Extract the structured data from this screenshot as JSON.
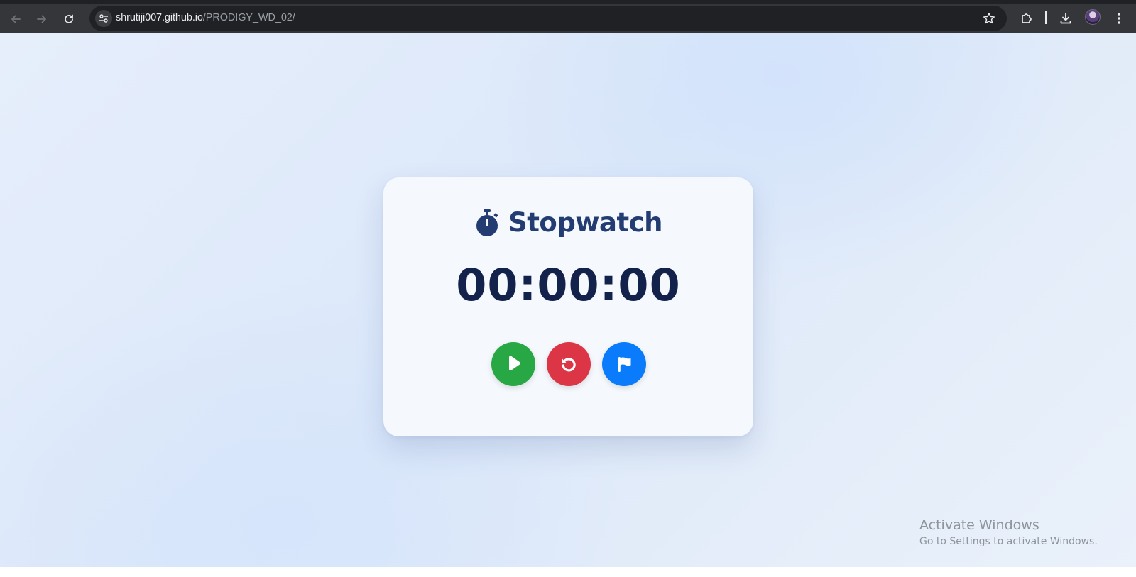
{
  "browser": {
    "url_host": "shrutiji007.github.io",
    "url_path": "/PRODIGY_WD_02/",
    "icons": {
      "back": "arrow-left-icon",
      "forward": "arrow-right-icon",
      "reload": "reload-icon",
      "site_info": "tune-icon",
      "bookmark": "star-icon",
      "extensions": "puzzle-icon",
      "downloads": "download-icon",
      "profile": "avatar",
      "menu": "kebab-menu-icon"
    }
  },
  "app": {
    "title": "Stopwatch",
    "title_icon": "stopwatch-icon",
    "time": "00:00:00",
    "buttons": [
      {
        "name": "start",
        "icon": "play-icon",
        "color": "#28a745"
      },
      {
        "name": "reset",
        "icon": "reset-icon",
        "color": "#dc3545"
      },
      {
        "name": "lap",
        "icon": "flag-icon",
        "color": "#0a7bfb"
      }
    ],
    "colors": {
      "title": "#233d73",
      "timer": "#13224a",
      "card_bg": "#f5f8fd"
    }
  },
  "watermark": {
    "title": "Activate Windows",
    "subtitle": "Go to Settings to activate Windows."
  }
}
